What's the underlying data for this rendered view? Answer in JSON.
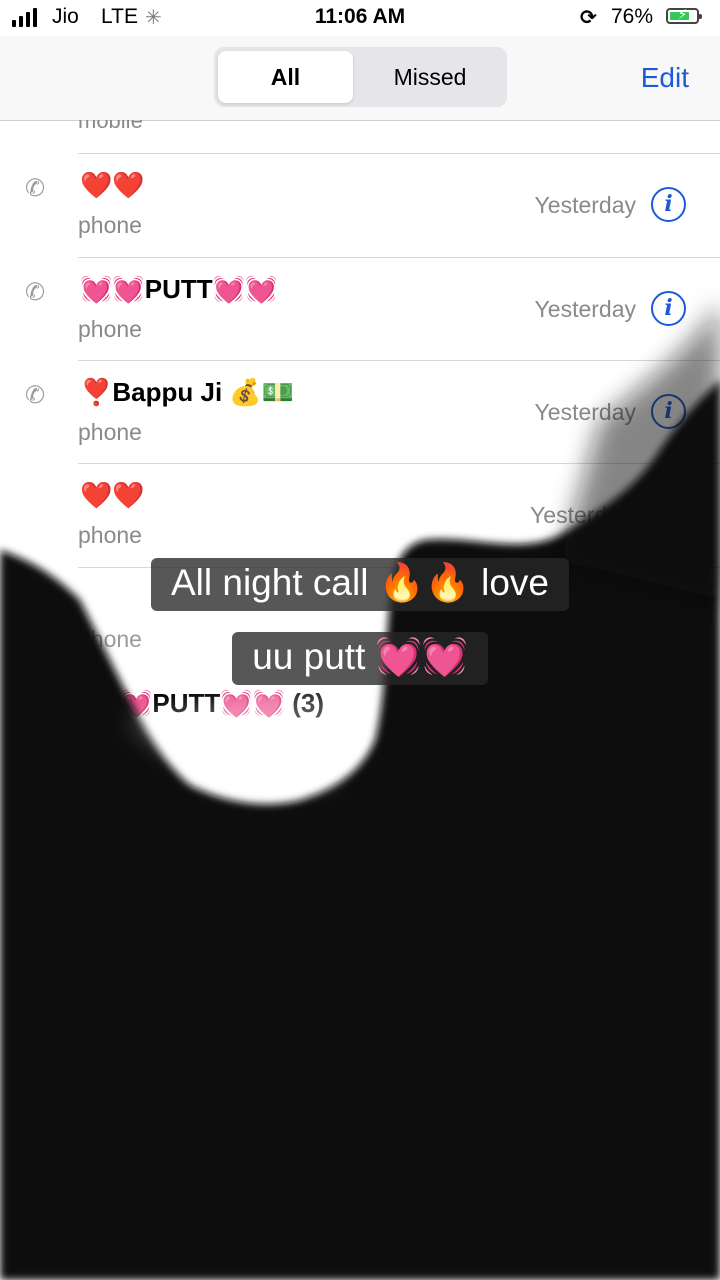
{
  "status_bar": {
    "carrier": "Jio",
    "network": "LTE",
    "time": "11:06 AM",
    "battery_percent": "76%",
    "battery_level": 0.76,
    "signal_bars": 4,
    "icons": [
      "signal-icon",
      "loading-spinner-icon",
      "rotation-lock-icon",
      "battery-charging-icon"
    ]
  },
  "header": {
    "segments": [
      "All",
      "Missed"
    ],
    "selected_segment": "All",
    "edit_label": "Edit"
  },
  "calls": {
    "partial_top": {
      "type": "mobile"
    },
    "rows": [
      {
        "name": "❤️❤️",
        "type": "phone",
        "date": "Yesterday"
      },
      {
        "name": "💓💓PUTT💓💓",
        "type": "phone",
        "date": "Yesterday"
      },
      {
        "name": "❣️Bappu Ji 💰💵",
        "type": "phone",
        "date": "Yesterday"
      },
      {
        "name": "❤️❤️",
        "type": "phone",
        "date": "Yesterda"
      },
      {
        "name": "",
        "type": "phone",
        "date": ""
      }
    ],
    "faint_row": {
      "name": "💓PUTT💓💓 (3)"
    }
  },
  "caption": {
    "line1": "All night call 🔥🔥 love",
    "line2": "uu putt 💓💓"
  },
  "colors": {
    "accent": "#1d5bd6",
    "secondary_text": "#8a8a8e",
    "overlay": "#07070b"
  }
}
